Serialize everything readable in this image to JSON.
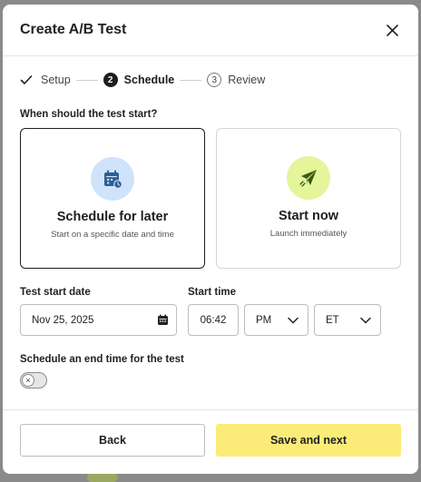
{
  "modal": {
    "title": "Create A/B Test"
  },
  "steps": [
    {
      "label": "Setup",
      "state": "complete"
    },
    {
      "number": "2",
      "label": "Schedule",
      "state": "active"
    },
    {
      "number": "3",
      "label": "Review",
      "state": "upcoming"
    }
  ],
  "start_question": "When should the test start?",
  "options": {
    "later": {
      "title": "Schedule for later",
      "description": "Start on a specific date and time",
      "selected": true,
      "icon": "calendar-icon"
    },
    "now": {
      "title": "Start now",
      "description": "Launch immediately",
      "selected": false,
      "icon": "paper-plane-icon"
    }
  },
  "date_field": {
    "label": "Test start date",
    "value": "Nov 25, 2025",
    "icon": "calendar-icon"
  },
  "time_field": {
    "label": "Start time",
    "value": "06:42",
    "ampm": "PM",
    "timezone": "ET"
  },
  "end_time": {
    "label": "Schedule an end time for the test",
    "enabled": false
  },
  "footer": {
    "back_label": "Back",
    "next_label": "Save and next"
  },
  "colors": {
    "accent_button": "#fbec7a",
    "later_icon_bg": "#cfe3fb",
    "later_icon": "#2d5f94",
    "now_icon_bg": "#e4f59a",
    "now_icon": "#3a5a12"
  }
}
